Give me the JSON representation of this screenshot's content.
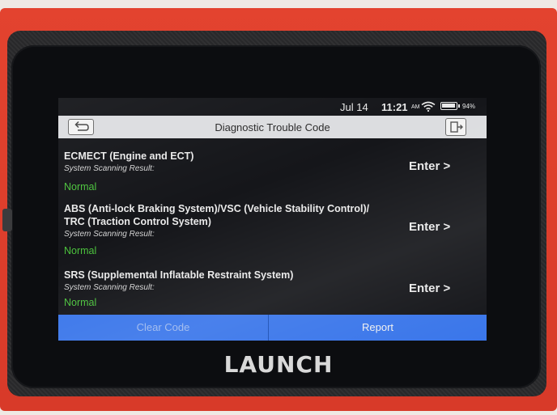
{
  "status": {
    "date": "Jul 14",
    "time": "11:21",
    "ampm": "AM",
    "battery": "94%",
    "battery_level": 0.94
  },
  "header": {
    "title": "Diagnostic Trouble Code",
    "back_icon": "back-arrow-icon",
    "exit_icon": "exit-icon"
  },
  "systems": [
    {
      "name": "ECMECT (Engine and ECT)",
      "label": "System Scanning Result:",
      "result": "Normal",
      "action": "Enter >"
    },
    {
      "name": "ABS (Anti-lock Braking System)/VSC (Vehicle Stability Control)/",
      "name_line2": "TRC (Traction Control System)",
      "label": "System Scanning Result:",
      "result": "Normal",
      "action": "Enter >"
    },
    {
      "name": "SRS (Supplemental Inflatable Restraint System)",
      "label": "System Scanning Result:",
      "result": "Normal",
      "action": "Enter >"
    }
  ],
  "footer": {
    "clear_label": "Clear Code",
    "report_label": "Report"
  },
  "device": {
    "brand": "LAUNCH"
  },
  "colors": {
    "accent": "#3a76ea",
    "ok": "#4cc33d",
    "casing": "#d83a29"
  }
}
